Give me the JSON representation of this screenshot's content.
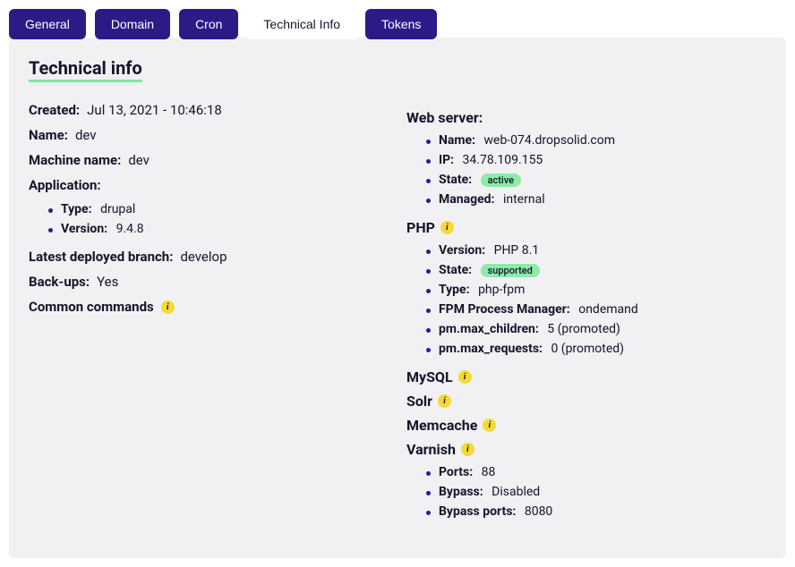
{
  "tabs": {
    "general": "General",
    "domain": "Domain",
    "cron": "Cron",
    "technical_info": "Technical Info",
    "tokens": "Tokens"
  },
  "panel_title": "Technical info",
  "left": {
    "created_label": "Created:",
    "created_value": "Jul 13, 2021 - 10:46:18",
    "name_label": "Name:",
    "name_value": "dev",
    "machine_name_label": "Machine name:",
    "machine_name_value": "dev",
    "application_label": "Application:",
    "app_type_label": "Type:",
    "app_type_value": "drupal",
    "app_version_label": "Version:",
    "app_version_value": "9.4.8",
    "latest_branch_label": "Latest deployed branch:",
    "latest_branch_value": "develop",
    "backups_label": "Back-ups:",
    "backups_value": "Yes",
    "common_commands_label": "Common commands"
  },
  "right": {
    "webserver_label": "Web server:",
    "ws_name_label": "Name:",
    "ws_name_value": "web-074.dropsolid.com",
    "ws_ip_label": "IP:",
    "ws_ip_value": "34.78.109.155",
    "ws_state_label": "State:",
    "ws_state_value": "active",
    "ws_managed_label": "Managed:",
    "ws_managed_value": "internal",
    "php_label": "PHP",
    "php_version_label": "Version:",
    "php_version_value": "PHP 8.1",
    "php_state_label": "State:",
    "php_state_value": "supported",
    "php_type_label": "Type:",
    "php_type_value": "php-fpm",
    "php_fpm_label": "FPM Process Manager:",
    "php_fpm_value": "ondemand",
    "php_maxchildren_label": "pm.max_children:",
    "php_maxchildren_value": "5 (promoted)",
    "php_maxrequests_label": "pm.max_requests:",
    "php_maxrequests_value": "0 (promoted)",
    "mysql_label": "MySQL",
    "solr_label": "Solr",
    "memcache_label": "Memcache",
    "varnish_label": "Varnish",
    "varnish_ports_label": "Ports:",
    "varnish_ports_value": "88",
    "varnish_bypass_label": "Bypass:",
    "varnish_bypass_value": "Disabled",
    "varnish_bypassports_label": "Bypass ports:",
    "varnish_bypassports_value": "8080"
  },
  "icon_glyph": "i"
}
